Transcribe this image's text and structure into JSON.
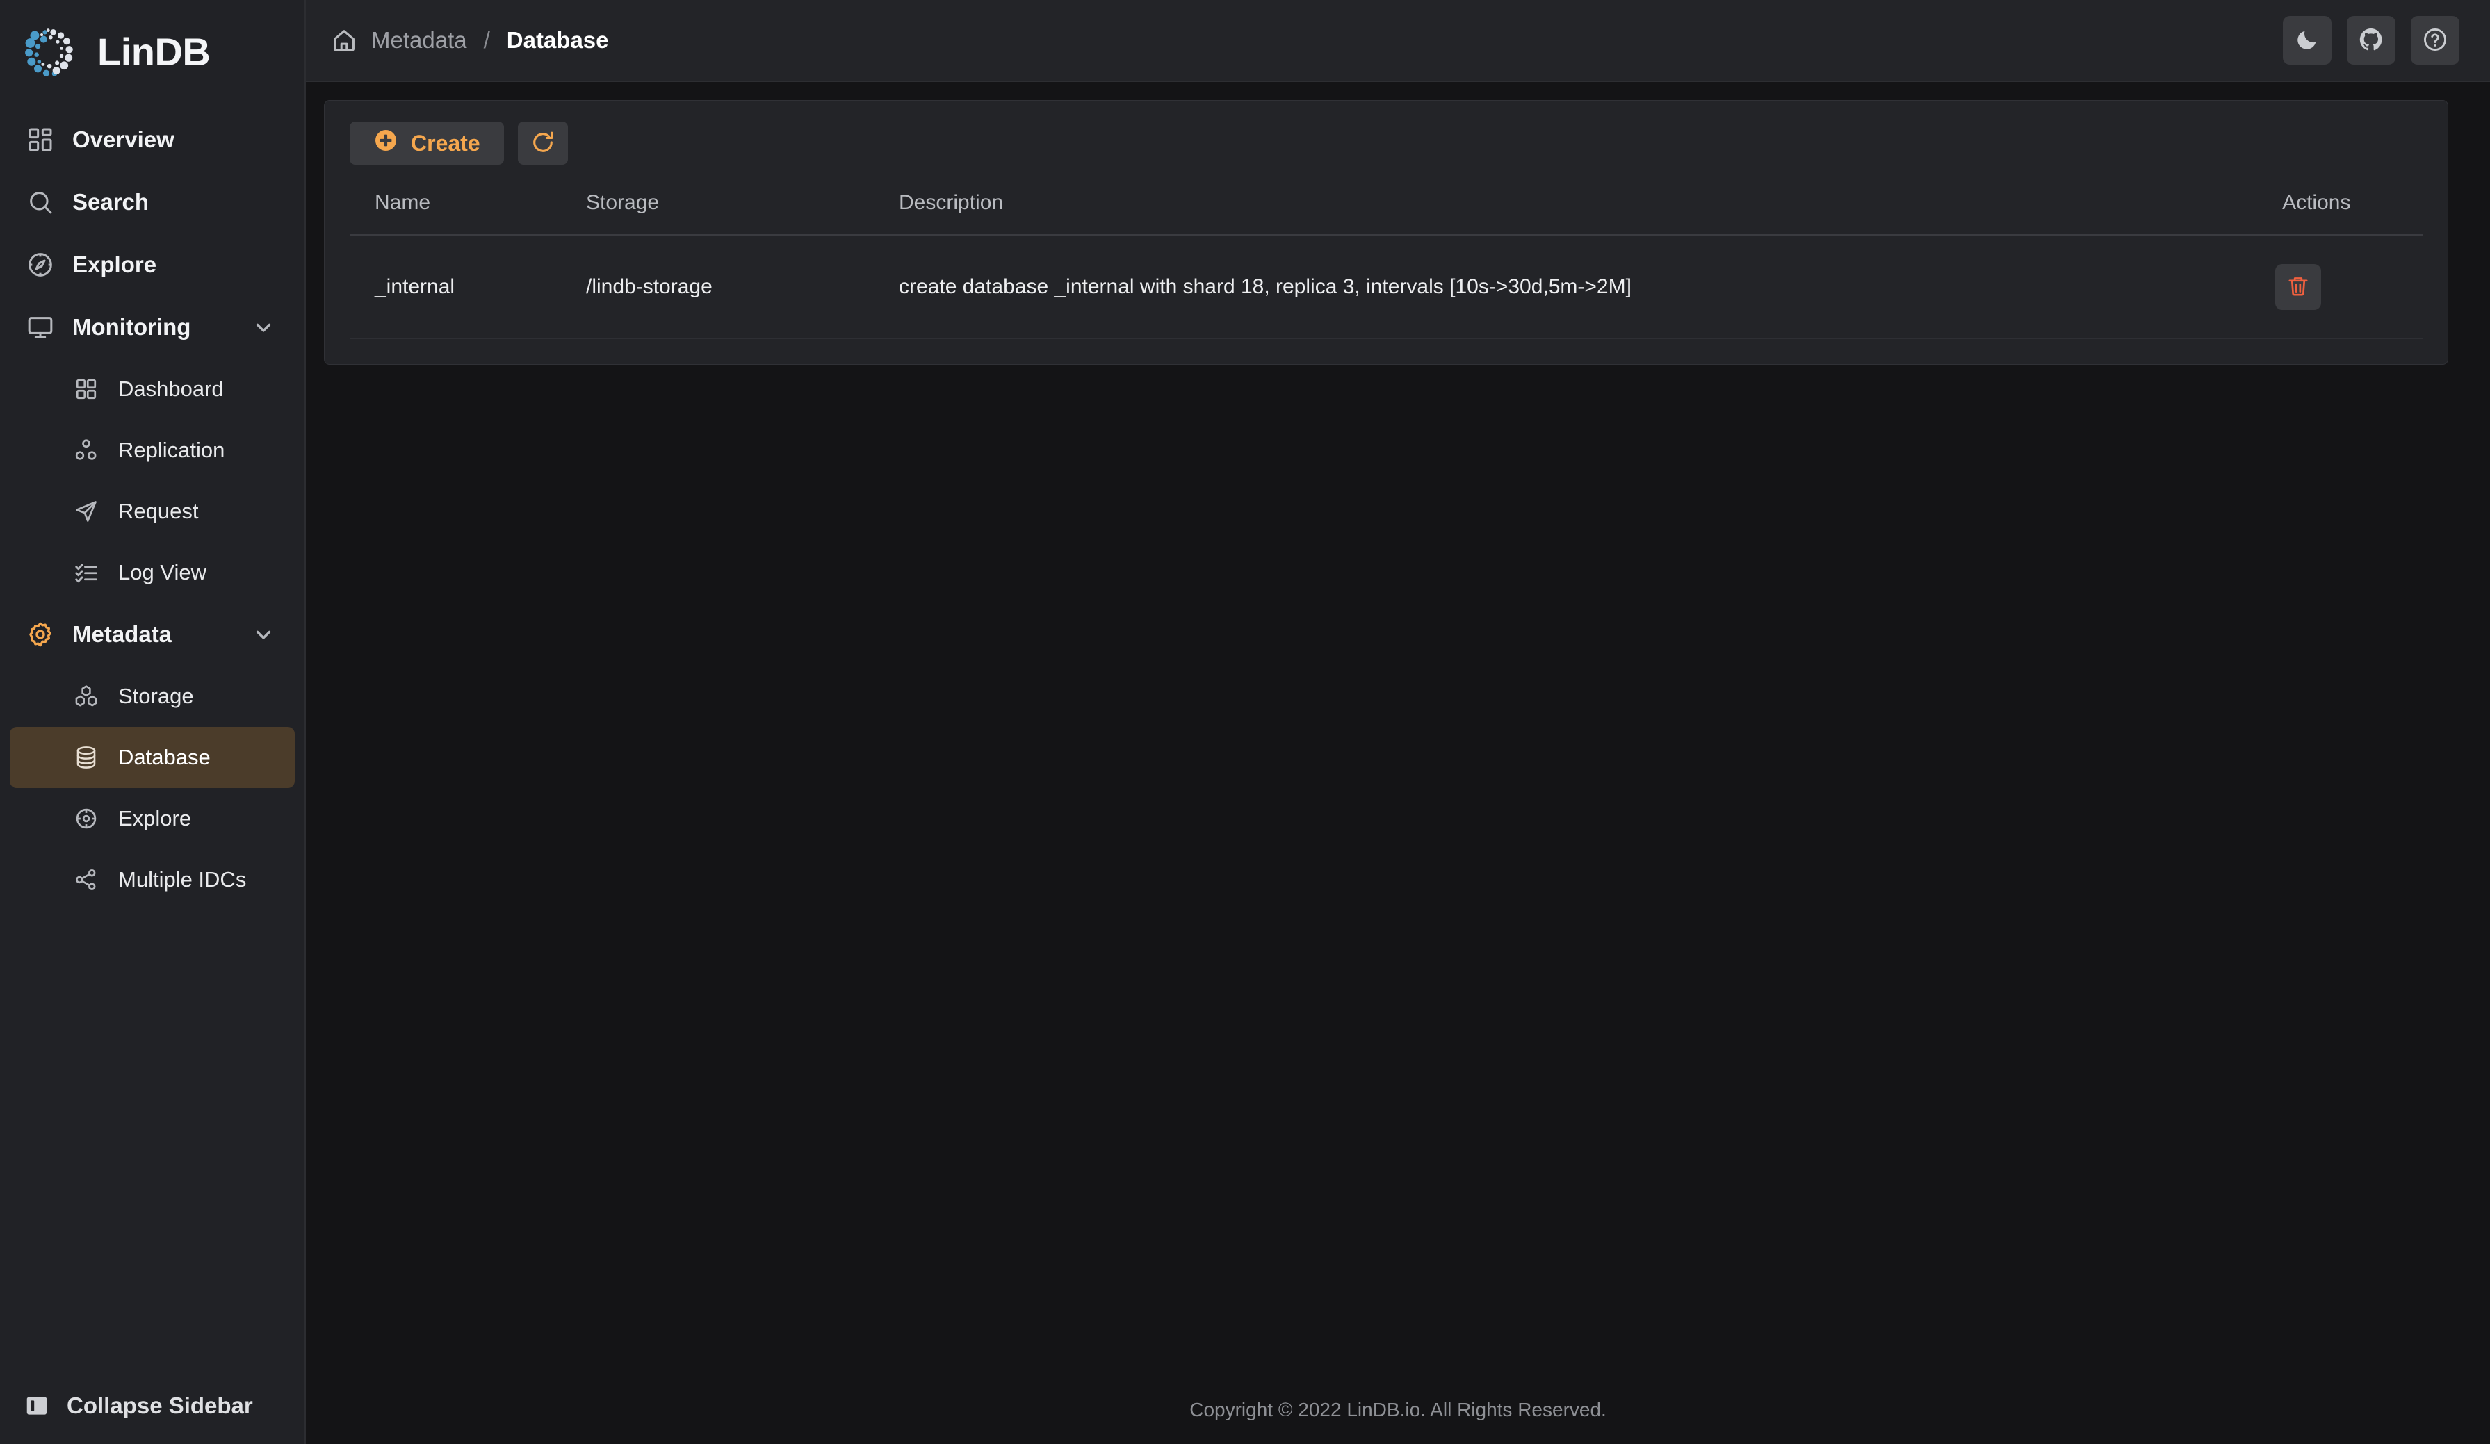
{
  "brand": {
    "name": "LinDB",
    "logo_icon": "lindb-dots-logo"
  },
  "sidebar": {
    "items": [
      {
        "label": "Overview",
        "icon": "layout-grid-icon",
        "level": "top",
        "active": false,
        "expandable": false
      },
      {
        "label": "Search",
        "icon": "search-icon",
        "level": "top",
        "active": false,
        "expandable": false
      },
      {
        "label": "Explore",
        "icon": "compass-icon",
        "level": "top",
        "active": false,
        "expandable": false
      },
      {
        "label": "Monitoring",
        "icon": "monitor-icon",
        "level": "top",
        "active": false,
        "expandable": true
      },
      {
        "label": "Dashboard",
        "icon": "grid-four-icon",
        "level": "sub",
        "active": false,
        "expandable": false
      },
      {
        "label": "Replication",
        "icon": "replication-nodes-icon",
        "level": "sub",
        "active": false,
        "expandable": false
      },
      {
        "label": "Request",
        "icon": "send-paper-plane-icon",
        "level": "sub",
        "active": false,
        "expandable": false
      },
      {
        "label": "Log View",
        "icon": "checklist-icon",
        "level": "sub",
        "active": false,
        "expandable": false
      },
      {
        "label": "Metadata",
        "icon": "gear-icon",
        "level": "top",
        "active": false,
        "expandable": true,
        "icon_accent": true
      },
      {
        "label": "Storage",
        "icon": "hexagon-cluster-icon",
        "level": "sub",
        "active": false,
        "expandable": false
      },
      {
        "label": "Database",
        "icon": "database-cylinder-icon",
        "level": "sub",
        "active": true,
        "expandable": false
      },
      {
        "label": "Explore",
        "icon": "aperture-icon",
        "level": "sub",
        "active": false,
        "expandable": false
      },
      {
        "label": "Multiple IDCs",
        "icon": "share-nodes-icon",
        "level": "sub",
        "active": false,
        "expandable": false
      }
    ],
    "collapse": {
      "label": "Collapse Sidebar",
      "icon": "panel-collapse-icon"
    }
  },
  "topbar": {
    "breadcrumb": {
      "home_icon": "home-icon",
      "parent": "Metadata",
      "separator": "/",
      "current": "Database"
    },
    "actions": [
      {
        "name": "theme-toggle-button",
        "icon": "moon-icon"
      },
      {
        "name": "github-link-button",
        "icon": "github-icon"
      },
      {
        "name": "help-button",
        "icon": "question-circle-icon"
      }
    ]
  },
  "toolbar": {
    "create_label": "Create",
    "create_icon": "plus-circle-icon",
    "refresh_icon": "refresh-icon"
  },
  "table": {
    "columns": [
      "Name",
      "Storage",
      "Description",
      "Actions"
    ],
    "rows": [
      {
        "name": "_internal",
        "storage": "/lindb-storage",
        "description": "create database _internal with shard 18, replica 3, intervals [10s->30d,5m->2M]",
        "action_icon": "trash-icon"
      }
    ]
  },
  "footer": {
    "copyright": "Copyright © 2022 LinDB.io. All Rights Reserved."
  },
  "colors": {
    "accent_orange": "#f5a74e",
    "danger_red": "#f0603f",
    "active_nav_bg": "#4b3c2a",
    "sidebar_bg": "#212226",
    "card_bg": "#232428",
    "content_bg": "#141416"
  }
}
